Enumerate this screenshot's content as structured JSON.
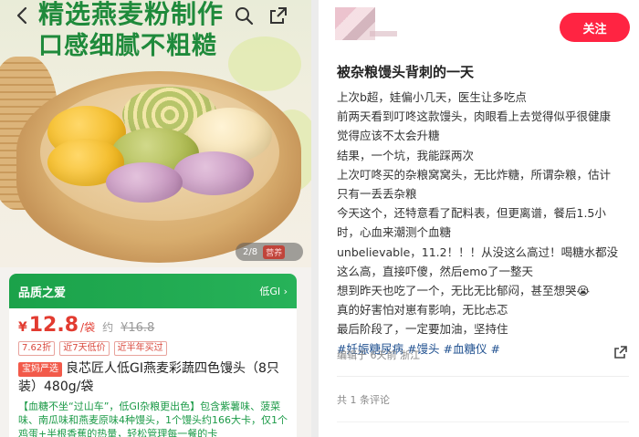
{
  "product": {
    "hero_line1": "精选燕麦粉制作",
    "hero_line2": "口感细腻不粗糙",
    "pager": "2/8",
    "pager_tag": "营养",
    "card_title": "品质之爱",
    "card_gi": "低GI ›",
    "price_symbol": "¥",
    "price_value": "12.8",
    "price_unit": "/袋",
    "price_approx": "约",
    "price_old": "¥16.8",
    "tags": [
      "7.62折",
      "近7天低价",
      "近半年买过"
    ],
    "name_badge": "宝妈严选",
    "name": "良芯匠人低GI燕麦彩蔬四色馒头（8只装）480g/袋",
    "desc": "【血糖不坐“过山车”，低GI杂粮更出色】包含紫薯味、菠菜味、南瓜味和燕麦原味4种馒头，1个馒头约166大卡，仅1个鸡蛋+半根香蕉的热量，轻松管理每一餐的卡"
  },
  "post": {
    "follow_label": "关注",
    "title": "被杂粮馒头背刺的一天",
    "lines": [
      "上次b超，娃偏小几天，医生让多吃点",
      "前两天看到叮咚这款馒头，肉眼看上去觉得似乎很健康",
      "觉得应该不太会升糖",
      "结果，一个坑，我能踩两次",
      "上次叮咚买的杂粮窝窝头，无比炸糖，所谓杂粮，估计",
      "只有一丢丢杂粮",
      "今天这个，还特意看了配料表，但更离谱，餐后1.5小",
      "时，心血来潮测个血糖",
      "unbelievable，11.2！！！从没这么高过！喝糖水都没",
      "这么高，直接吓傻，然后emo了一整天",
      "想到昨天也吃了一个，无比无比郁闷，甚至想哭😭",
      "真的好害怕对崽有影响，无比忐忑",
      "最后阶段了，一定要加油，坚持住"
    ],
    "hashtags": [
      "#妊娠糖尿病",
      "#馒头",
      "#血糖仪",
      "#"
    ],
    "meta": "编辑于 6天前 浙江",
    "comments": "共 1 条评论"
  },
  "colors": {
    "accent_red": "#ff2442",
    "green": "#1ba24a",
    "price_red": "#e23b30",
    "link_blue": "#1e4f8f"
  },
  "icons": [
    "back-arrow-icon",
    "search-icon",
    "share-icon"
  ]
}
